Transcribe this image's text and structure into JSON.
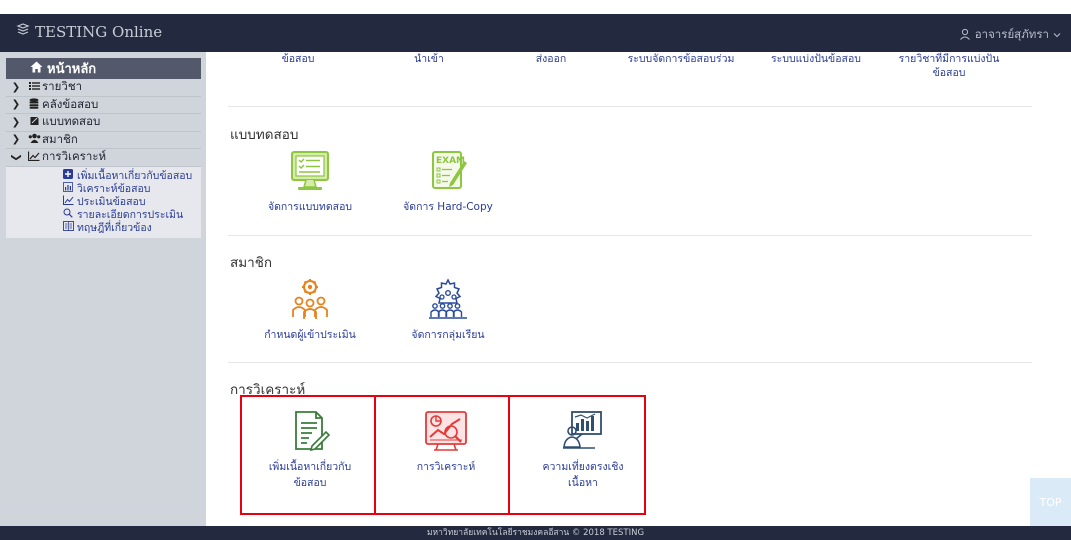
{
  "app": {
    "brand": "TESTING Online",
    "user_name": "อาจารย์สุภัทรา"
  },
  "sidebar": {
    "home_label": "หน้าหลัก",
    "items": [
      {
        "label": "รายวิชา",
        "icon": "list-icon",
        "expanded": false
      },
      {
        "label": "คลังข้อสอบ",
        "icon": "database-icon",
        "expanded": false
      },
      {
        "label": "แบบทดสอบ",
        "icon": "pen-icon",
        "expanded": false
      },
      {
        "label": "สมาชิก",
        "icon": "users-icon",
        "expanded": false
      },
      {
        "label": "การวิเคราะห์",
        "icon": "line-chart-icon",
        "expanded": true
      }
    ],
    "sub_items": [
      {
        "label": "เพิ่มเนื้อหาเกี่ยวกับข้อสอบ",
        "icon": "plus-square-icon"
      },
      {
        "label": "วิเคราะห์ข้อสอบ",
        "icon": "bar-chart-icon"
      },
      {
        "label": "ประเมินข้อสอบ",
        "icon": "line-chart-icon"
      },
      {
        "label": "รายละเอียดการประเมิน",
        "icon": "search-icon"
      },
      {
        "label": "ทฤษฎีที่เกี่ยวข้อง",
        "icon": "book-icon"
      }
    ]
  },
  "top_row": {
    "items": [
      {
        "line1": "ข้อสอบ",
        "line2": ""
      },
      {
        "line1": "นำเข้า",
        "line2": ""
      },
      {
        "line1": "ส่งออก",
        "line2": ""
      },
      {
        "line1": "ระบบจัดการข้อสอบร่วม",
        "line2": ""
      },
      {
        "line1": "ระบบแบ่งปันข้อสอบ",
        "line2": ""
      },
      {
        "line1": "รายวิชาที่มีการแบ่งปัน",
        "line2": "ข้อสอบ"
      }
    ]
  },
  "sections": {
    "test": {
      "title": "แบบทดสอบ",
      "tiles": [
        {
          "label": "จัดการแบบทดสอบ",
          "icon": "monitor-checklist-icon"
        },
        {
          "label": "จัดการ Hard-Copy",
          "icon": "exam-paper-icon"
        }
      ]
    },
    "member": {
      "title": "สมาชิก",
      "tiles": [
        {
          "label": "กำหนดผู้เข้าประเมิน",
          "icon": "people-gear-icon"
        },
        {
          "label": "จัดการกลุ่มเรียน",
          "icon": "group-gear-icon"
        }
      ]
    },
    "analysis": {
      "title": "การวิเคราะห์",
      "tiles": [
        {
          "line1": "เพิ่มเนื้อหาเกี่ยวกับ",
          "line2": "ข้อสอบ",
          "icon": "document-edit-icon"
        },
        {
          "line1": "การวิเคราะห์",
          "line2": "",
          "icon": "analysis-chart-icon"
        },
        {
          "line1": "ความเที่ยงตรงเชิง",
          "line2": "เนื้อหา",
          "icon": "presentation-chart-icon"
        }
      ]
    }
  },
  "footer": {
    "text": "มหาวิทยาลัยเทคโนโลยีราชมงคลอีสาน © 2018 TESTING"
  },
  "top_button": {
    "label": "TOP"
  },
  "colors": {
    "topbar": "#232a40",
    "sidebar": "#d0d4db",
    "link": "#2a3c95",
    "highlight": "#e8000e",
    "green": "#8dc63f",
    "orange": "#e8821e"
  }
}
